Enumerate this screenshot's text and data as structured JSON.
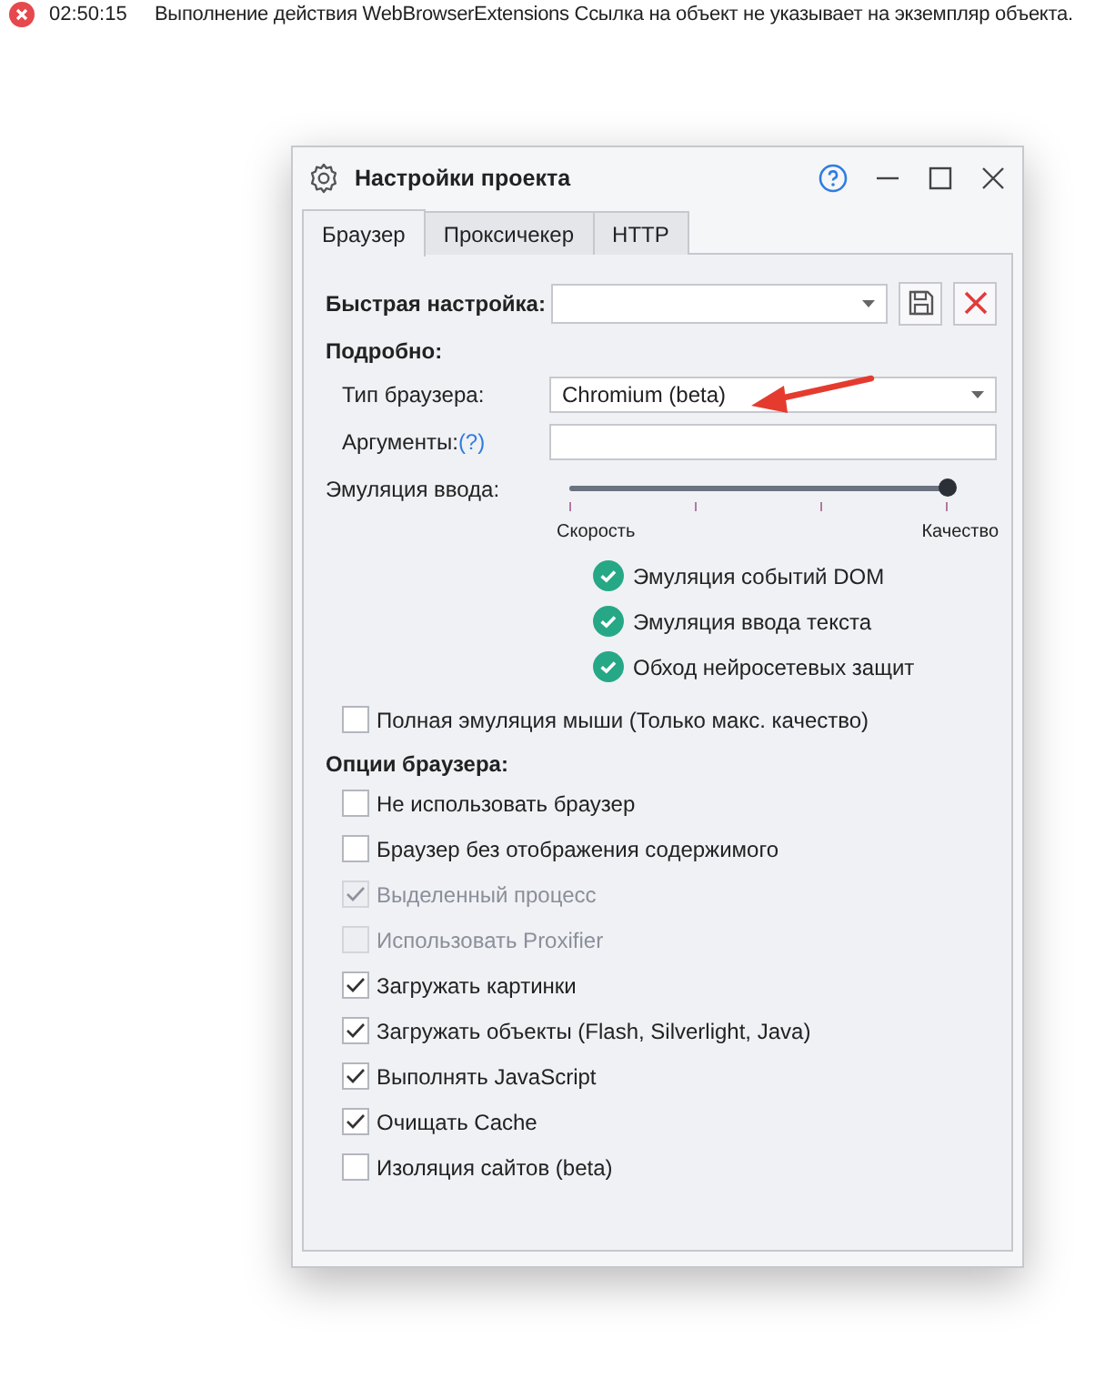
{
  "log": {
    "time": "02:50:15",
    "message": "Выполнение действия WebBrowserExtensions Ссылка на объект не указывает на экземпляр объекта."
  },
  "dialog": {
    "title": "Настройки проекта",
    "tabs": [
      {
        "label": "Браузер",
        "selected": true
      },
      {
        "label": "Проксичекер",
        "selected": false
      },
      {
        "label": "HTTP",
        "selected": false
      }
    ],
    "quick_setup": {
      "label": "Быстрая настройка:"
    },
    "details": {
      "heading": "Подробно:",
      "browser_type": {
        "label": "Тип браузера:",
        "value": "Chromium (beta)"
      },
      "arguments": {
        "label": "Аргументы:",
        "help": "(?)"
      },
      "input_emulation": {
        "label": "Эмуляция ввода:",
        "level": 1,
        "min_label": "Скорость",
        "max_label": "Качество",
        "features": [
          {
            "label": "Эмуляция событий DOM",
            "enabled": true
          },
          {
            "label": "Эмуляция ввода текста",
            "enabled": true
          },
          {
            "label": "Обход нейросетевых защит",
            "enabled": true
          }
        ]
      }
    },
    "full_mouse_emulation": {
      "label": "Полная эмуляция мыши (Только макс. качество)",
      "checked": false
    },
    "browser_options": {
      "heading": "Опции браузера:",
      "items": [
        {
          "label": "Не использовать браузер",
          "checked": false,
          "disabled": false
        },
        {
          "label": "Браузер без отображения содержимого",
          "checked": false,
          "disabled": false
        },
        {
          "label": "Выделенный процесс",
          "checked": true,
          "disabled": true
        },
        {
          "label": "Использовать Proxifier",
          "checked": false,
          "disabled": true
        },
        {
          "label": "Загружать картинки",
          "checked": true,
          "disabled": false
        },
        {
          "label": "Загружать объекты (Flash, Silverlight, Java)",
          "checked": true,
          "disabled": false
        },
        {
          "label": "Выполнять JavaScript",
          "checked": true,
          "disabled": false
        },
        {
          "label": "Очищать Cache",
          "checked": true,
          "disabled": false
        },
        {
          "label": "Изоляция сайтов (beta)",
          "checked": false,
          "disabled": false
        }
      ]
    }
  }
}
